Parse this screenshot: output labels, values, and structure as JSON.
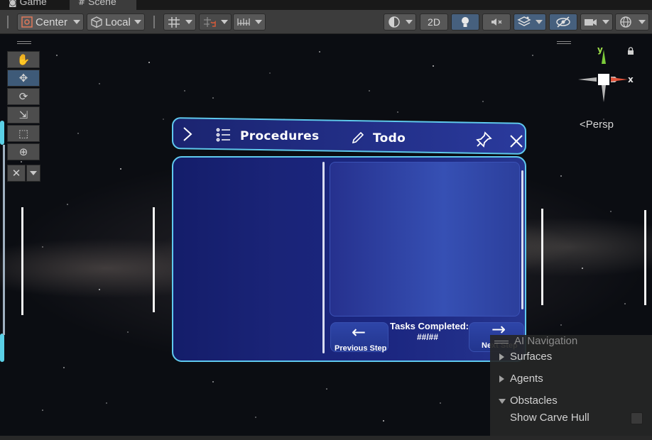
{
  "tabs": [
    {
      "label": "Game",
      "icon": "game-controller-icon"
    },
    {
      "label": "Scene",
      "icon": "hash-icon"
    }
  ],
  "toolbar": {
    "pivot_mode": "Center",
    "pivot_rotation": "Local",
    "view_2d_label": "2D"
  },
  "gizmo": {
    "axis_y": "y",
    "axis_x": "x",
    "projection_label": "<Persp"
  },
  "holo_window": {
    "procedures_title": "Procedures",
    "todo_title": "Todo",
    "tasks_label": "Tasks Completed:",
    "tasks_value": "##/##",
    "prev_label": "Previous Step",
    "next_label": "Next Step",
    "header_color": "#1b2470",
    "border_color": "#5fc9ee"
  },
  "ai_navigation": {
    "title": "AI Navigation",
    "items": [
      {
        "label": "Surfaces",
        "expanded": false
      },
      {
        "label": "Agents",
        "expanded": false
      },
      {
        "label": "Obstacles",
        "expanded": true
      }
    ],
    "show_carve_hull_label": "Show Carve Hull",
    "show_carve_hull_checked": false
  }
}
